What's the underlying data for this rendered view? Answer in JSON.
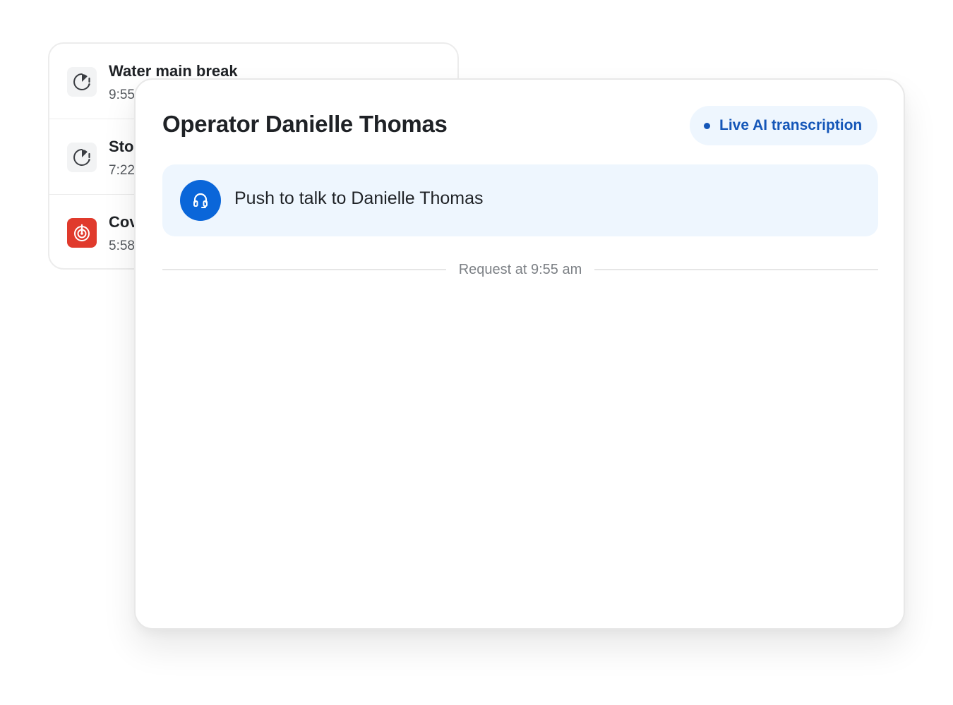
{
  "incidents": [
    {
      "title": "Water main break",
      "time": "9:55",
      "icon": "clock-alert-icon"
    },
    {
      "title": "Sto",
      "time": "7:22",
      "icon": "clock-alert-icon"
    },
    {
      "title": "Cov",
      "time": "5:58",
      "icon": "alarm-icon"
    }
  ],
  "operator": {
    "title": "Operator Danielle Thomas",
    "live_badge": "Live AI transcription",
    "push_to_talk_label": "Push to talk to Danielle Thomas",
    "push_to_talk_icon": "headset-icon",
    "request_label": "Request at 9:55 am"
  },
  "colors": {
    "accent": "#0a66d9",
    "accent_text": "#1456b8",
    "accent_bg": "#eef6fe",
    "alert": "#e03a2c"
  }
}
